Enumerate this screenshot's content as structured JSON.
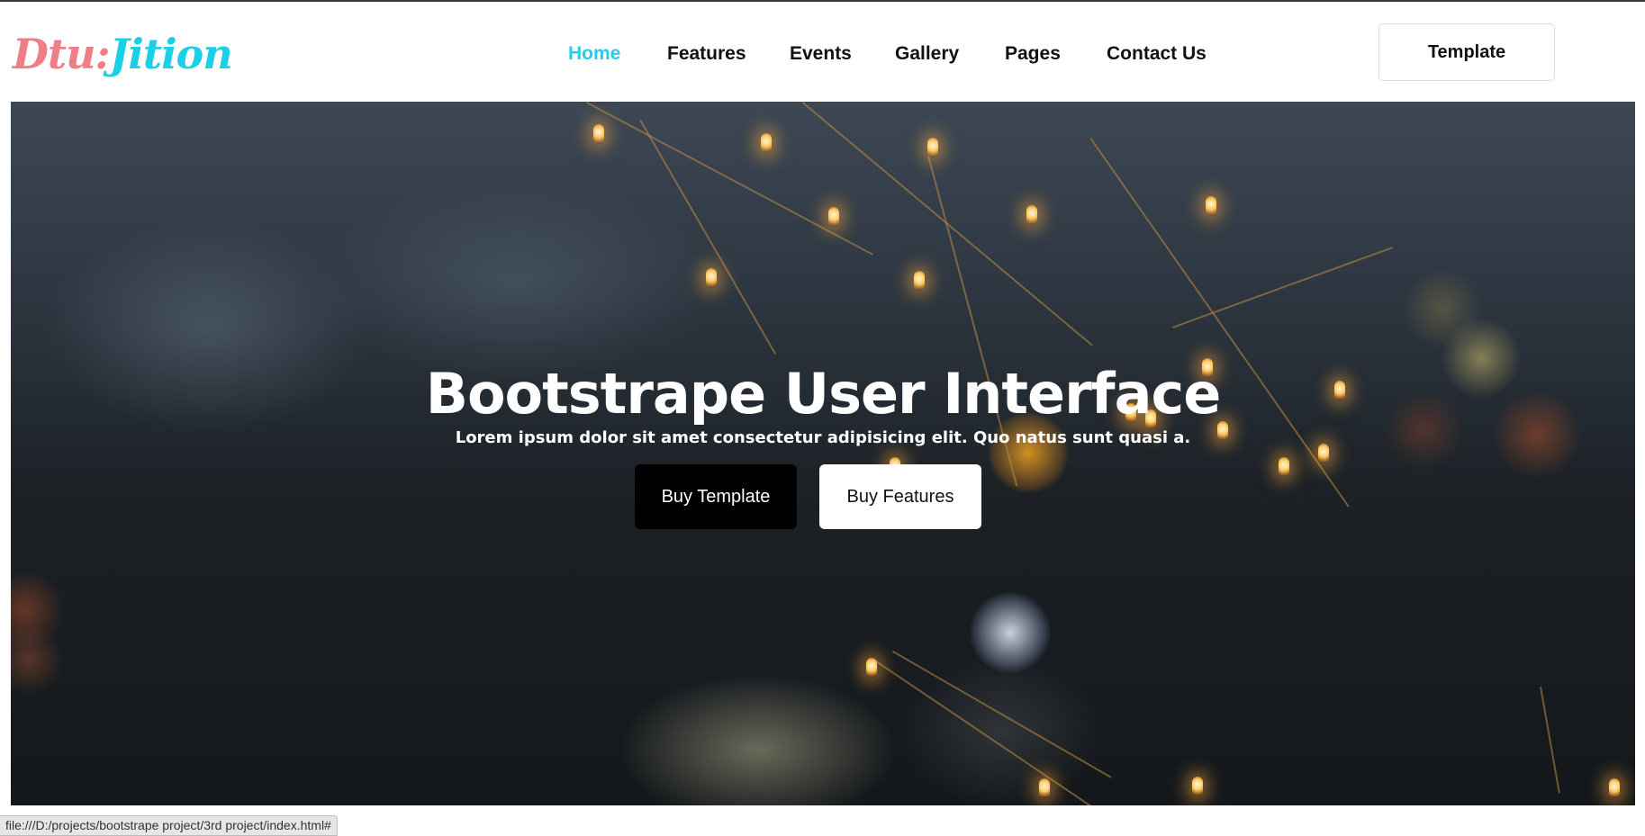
{
  "logo": {
    "part1": "Dtu:",
    "part2": "Jition"
  },
  "nav": {
    "items": [
      {
        "label": "Home",
        "active": true
      },
      {
        "label": "Features",
        "active": false
      },
      {
        "label": "Events",
        "active": false
      },
      {
        "label": "Gallery",
        "active": false
      },
      {
        "label": "Pages",
        "active": false
      },
      {
        "label": "Contact Us",
        "active": false
      }
    ],
    "template_button": "Template"
  },
  "hero": {
    "title": "Bootstrape User Interface",
    "subtitle": "Lorem ipsum dolor sit amet consectetur adipisicing elit. Quo natus sunt quasi a.",
    "primary_button": "Buy Template",
    "secondary_button": "Buy Features"
  },
  "status_bar": {
    "url": "file:///D:/projects/bootstrape project/3rd project/index.html#"
  },
  "colors": {
    "accent": "#1fd0e8",
    "logo_pink": "#ef7f86",
    "logo_cyan": "#1bd0e6",
    "dark_button": "#000000",
    "light_button": "#ffffff"
  }
}
